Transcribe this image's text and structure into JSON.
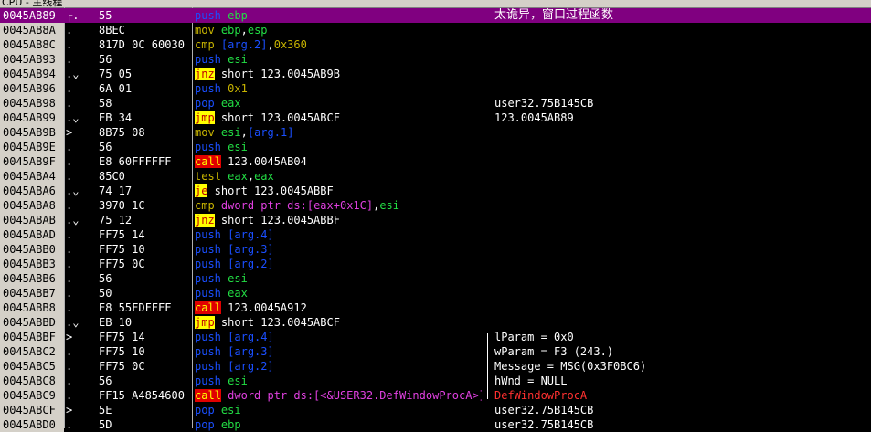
{
  "window": {
    "title": "CPU - 主线程"
  },
  "colors": {
    "selected_row": "#800080",
    "address_column": "#d4d0c8",
    "background": "#000000"
  },
  "rows": [
    {
      "addr": "0045AB89",
      "mark": "┌.",
      "hex": "55",
      "dis": [
        [
          "push",
          "blue"
        ],
        [
          " ",
          "white"
        ],
        [
          "ebp",
          "green"
        ]
      ],
      "cmt": "太诡异，窗口过程函数",
      "selected": true,
      "cmt_class": "cjk"
    },
    {
      "addr": "0045AB8A",
      "mark": ".",
      "hex": "8BEC",
      "dis": [
        [
          "mov",
          "olive"
        ],
        [
          " ",
          "white"
        ],
        [
          "ebp",
          "green"
        ],
        [
          ",",
          "white"
        ],
        [
          "esp",
          "green"
        ]
      ],
      "cmt": ""
    },
    {
      "addr": "0045AB8C",
      "mark": ".",
      "hex": "817D 0C 60030",
      "dis": [
        [
          "cmp",
          "olive"
        ],
        [
          " ",
          "white"
        ],
        [
          "[arg.2]",
          "blue"
        ],
        [
          ",",
          "white"
        ],
        [
          "0x360",
          "olive"
        ]
      ],
      "cmt": ""
    },
    {
      "addr": "0045AB93",
      "mark": ".",
      "hex": "56",
      "dis": [
        [
          "push",
          "blue"
        ],
        [
          " ",
          "white"
        ],
        [
          "esi",
          "green"
        ]
      ],
      "cmt": ""
    },
    {
      "addr": "0045AB94",
      "mark": ".⌄",
      "hex": "75 05",
      "dis": [
        [
          "jnz",
          "hl-y"
        ],
        [
          " short 123.0045AB9B",
          "white"
        ]
      ],
      "cmt": ""
    },
    {
      "addr": "0045AB96",
      "mark": ".",
      "hex": "6A 01",
      "dis": [
        [
          "push",
          "blue"
        ],
        [
          " ",
          "white"
        ],
        [
          "0x1",
          "olive"
        ]
      ],
      "cmt": ""
    },
    {
      "addr": "0045AB98",
      "mark": ".",
      "hex": "58",
      "dis": [
        [
          "pop",
          "blue"
        ],
        [
          " ",
          "white"
        ],
        [
          "eax",
          "green"
        ]
      ],
      "cmt": "user32.75B145CB"
    },
    {
      "addr": "0045AB99",
      "mark": ".⌄",
      "hex": "EB 34",
      "dis": [
        [
          "jmp",
          "hl-y"
        ],
        [
          " short 123.0045ABCF",
          "white"
        ]
      ],
      "cmt": "123.0045AB89"
    },
    {
      "addr": "0045AB9B",
      "mark": ">",
      "hex": "8B75 08",
      "dis": [
        [
          "mov",
          "olive"
        ],
        [
          " ",
          "white"
        ],
        [
          "esi",
          "green"
        ],
        [
          ",",
          "white"
        ],
        [
          "[arg.1]",
          "blue"
        ]
      ],
      "cmt": ""
    },
    {
      "addr": "0045AB9E",
      "mark": ".",
      "hex": "56",
      "dis": [
        [
          "push",
          "blue"
        ],
        [
          " ",
          "white"
        ],
        [
          "esi",
          "green"
        ]
      ],
      "cmt": ""
    },
    {
      "addr": "0045AB9F",
      "mark": ".",
      "hex": "E8 60FFFFFF",
      "dis": [
        [
          "call",
          "hl-r"
        ],
        [
          " 123.0045AB04",
          "white"
        ]
      ],
      "cmt": ""
    },
    {
      "addr": "0045ABA4",
      "mark": ".",
      "hex": "85C0",
      "dis": [
        [
          "test",
          "olive"
        ],
        [
          " ",
          "white"
        ],
        [
          "eax",
          "green"
        ],
        [
          ",",
          "white"
        ],
        [
          "eax",
          "green"
        ]
      ],
      "cmt": ""
    },
    {
      "addr": "0045ABA6",
      "mark": ".⌄",
      "hex": "74 17",
      "dis": [
        [
          "je",
          "hl-y"
        ],
        [
          " short 123.0045ABBF",
          "white"
        ]
      ],
      "cmt": ""
    },
    {
      "addr": "0045ABA8",
      "mark": ".",
      "hex": "3970 1C",
      "dis": [
        [
          "cmp",
          "olive"
        ],
        [
          " ",
          "white"
        ],
        [
          "dword ptr ds:[eax+0x1C]",
          "mag"
        ],
        [
          ",",
          "white"
        ],
        [
          "esi",
          "green"
        ]
      ],
      "cmt": ""
    },
    {
      "addr": "0045ABAB",
      "mark": ".⌄",
      "hex": "75 12",
      "dis": [
        [
          "jnz",
          "hl-y"
        ],
        [
          " short 123.0045ABBF",
          "white"
        ]
      ],
      "cmt": ""
    },
    {
      "addr": "0045ABAD",
      "mark": ".",
      "hex": "FF75 14",
      "dis": [
        [
          "push",
          "blue"
        ],
        [
          " ",
          "white"
        ],
        [
          "[arg.4]",
          "blue"
        ]
      ],
      "cmt": ""
    },
    {
      "addr": "0045ABB0",
      "mark": ".",
      "hex": "FF75 10",
      "dis": [
        [
          "push",
          "blue"
        ],
        [
          " ",
          "white"
        ],
        [
          "[arg.3]",
          "blue"
        ]
      ],
      "cmt": ""
    },
    {
      "addr": "0045ABB3",
      "mark": ".",
      "hex": "FF75 0C",
      "dis": [
        [
          "push",
          "blue"
        ],
        [
          " ",
          "white"
        ],
        [
          "[arg.2]",
          "blue"
        ]
      ],
      "cmt": ""
    },
    {
      "addr": "0045ABB6",
      "mark": ".",
      "hex": "56",
      "dis": [
        [
          "push",
          "blue"
        ],
        [
          " ",
          "white"
        ],
        [
          "esi",
          "green"
        ]
      ],
      "cmt": ""
    },
    {
      "addr": "0045ABB7",
      "mark": ".",
      "hex": "50",
      "dis": [
        [
          "push",
          "blue"
        ],
        [
          " ",
          "white"
        ],
        [
          "eax",
          "green"
        ]
      ],
      "cmt": ""
    },
    {
      "addr": "0045ABB8",
      "mark": ".",
      "hex": "E8 55FDFFFF",
      "dis": [
        [
          "call",
          "hl-r"
        ],
        [
          " 123.0045A912",
          "white"
        ]
      ],
      "cmt": ""
    },
    {
      "addr": "0045ABBD",
      "mark": ".⌄",
      "hex": "EB 10",
      "dis": [
        [
          "jmp",
          "hl-y"
        ],
        [
          " short 123.0045ABCF",
          "white"
        ]
      ],
      "cmt": ""
    },
    {
      "addr": "0045ABBF",
      "mark": ">",
      "hex": "FF75 14",
      "dis": [
        [
          "push",
          "blue"
        ],
        [
          " ",
          "white"
        ],
        [
          "[arg.4]",
          "blue"
        ]
      ],
      "cmt": "lParam = 0x0"
    },
    {
      "addr": "0045ABC2",
      "mark": ".",
      "hex": "FF75 10",
      "dis": [
        [
          "push",
          "blue"
        ],
        [
          " ",
          "white"
        ],
        [
          "[arg.3]",
          "blue"
        ]
      ],
      "cmt": "wParam = F3 (243.)"
    },
    {
      "addr": "0045ABC5",
      "mark": ".",
      "hex": "FF75 0C",
      "dis": [
        [
          "push",
          "blue"
        ],
        [
          " ",
          "white"
        ],
        [
          "[arg.2]",
          "blue"
        ]
      ],
      "cmt": "Message = MSG(0x3F0BC6)"
    },
    {
      "addr": "0045ABC8",
      "mark": ".",
      "hex": "56",
      "dis": [
        [
          "push",
          "blue"
        ],
        [
          " ",
          "white"
        ],
        [
          "esi",
          "green"
        ]
      ],
      "cmt": "hWnd = NULL"
    },
    {
      "addr": "0045ABC9",
      "mark": ".",
      "hex": "FF15 A4854600",
      "dis": [
        [
          "call",
          "hl-r"
        ],
        [
          " ",
          "white"
        ],
        [
          "dword ptr ds:[<&USER32.DefWindowProcA>]",
          "mag"
        ]
      ],
      "cmt": "DefWindowProcA",
      "cmt_class": "red"
    },
    {
      "addr": "0045ABCF",
      "mark": ">",
      "hex": "5E",
      "dis": [
        [
          "pop",
          "blue"
        ],
        [
          " ",
          "white"
        ],
        [
          "esi",
          "green"
        ]
      ],
      "cmt": "user32.75B145CB"
    },
    {
      "addr": "0045ABD0",
      "mark": ".",
      "hex": "5D",
      "dis": [
        [
          "pop",
          "blue"
        ],
        [
          " ",
          "white"
        ],
        [
          "ebp",
          "green"
        ]
      ],
      "cmt": "user32.75B145CB"
    }
  ]
}
